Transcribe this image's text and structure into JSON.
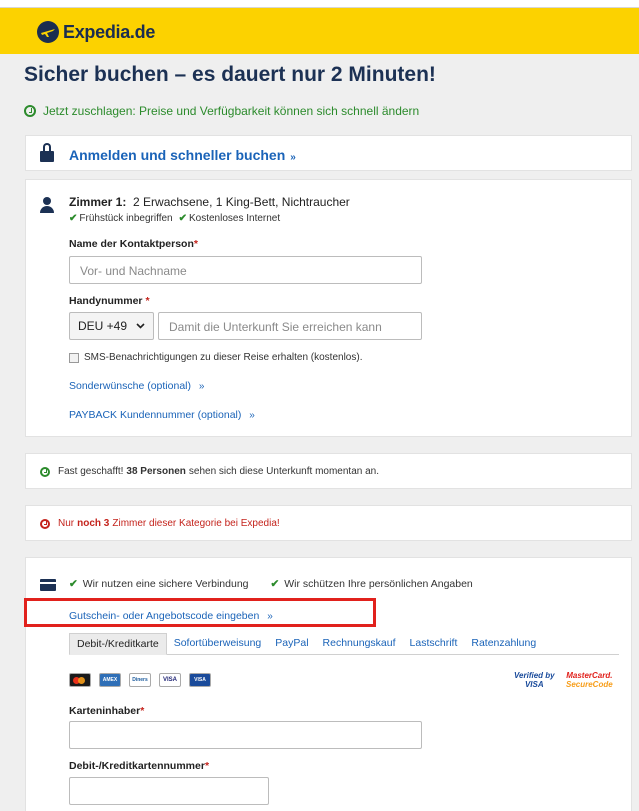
{
  "header": {
    "logo_text": "Expedia.de",
    "brand_color": "#fcd200"
  },
  "page": {
    "title": "Sicher buchen – es dauert nur 2 Minuten!",
    "urgency_text": "Jetzt zuschlagen: Preise und Verfügbarkeit können sich schnell ändern"
  },
  "login": {
    "label": "Anmelden und schneller buchen",
    "chevron": "»"
  },
  "room": {
    "label": "Zimmer 1:",
    "description": "2 Erwachsene, 1 King-Bett, Nichtraucher",
    "amenities": [
      "Frühstück inbegriffen",
      "Kostenloses Internet"
    ]
  },
  "contact": {
    "name_label": "Name der Kontaktperson",
    "name_placeholder": "Vor- und Nachname",
    "phone_label": "Handynummer",
    "country_code": "DEU +49",
    "phone_placeholder": "Damit die Unterkunft Sie erreichen kann",
    "sms_label": "SMS-Benachrichtigungen zu dieser Reise erhalten (kostenlos).",
    "special_requests": "Sonderwünsche (optional)",
    "payback": "PAYBACK Kundennummer (optional)",
    "required_mark": "*"
  },
  "notices": {
    "viewers_prefix": "Fast geschafft!",
    "viewers_count": "38 Personen",
    "viewers_suffix": "sehen sich diese Unterkunft momentan an.",
    "rooms_prefix": "Nur",
    "rooms_count": "noch 3",
    "rooms_suffix": "Zimmer dieser Kategorie bei Expedia!"
  },
  "payment": {
    "secure_connection": "Wir nutzen eine sichere Verbindung",
    "protect_data": "Wir schützen Ihre persönlichen Angaben",
    "voucher": "Gutschein- oder Angebotscode eingeben",
    "tabs": [
      "Debit-/Kreditkarte",
      "Sofortüberweisung",
      "PayPal",
      "Rechnungskauf",
      "Lastschrift",
      "Ratenzahlung"
    ],
    "card_brands": [
      "MC",
      "AMEX",
      "Diners",
      "VISA",
      "VISA"
    ],
    "verified_line1": "Verified by",
    "verified_line2": "VISA",
    "mc_secure_line1": "MasterCard.",
    "mc_secure_line2": "SecureCode",
    "holder_label": "Karteninhaber",
    "number_label": "Debit-/Kreditkartennummer"
  }
}
